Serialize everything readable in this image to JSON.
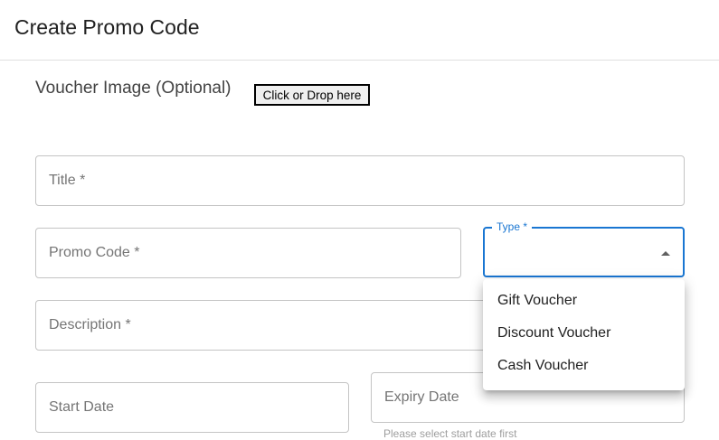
{
  "header": {
    "title": "Create Promo Code"
  },
  "voucher_image": {
    "label": "Voucher Image (Optional)",
    "drop_label": "Click or Drop here"
  },
  "form": {
    "title_label": "Title *",
    "promo_code_label": "Promo Code *",
    "type_label": "Type *",
    "description_label": "Description *",
    "start_date_label": "Start Date",
    "expiry_date_label": "Expiry Date",
    "expiry_helper": "Please select start date first"
  },
  "type_menu": {
    "options": [
      "Gift Voucher",
      "Discount Voucher",
      "Cash Voucher"
    ]
  },
  "colors": {
    "accent": "#1976d2",
    "border": "#c4c4c4",
    "label": "#757575"
  }
}
